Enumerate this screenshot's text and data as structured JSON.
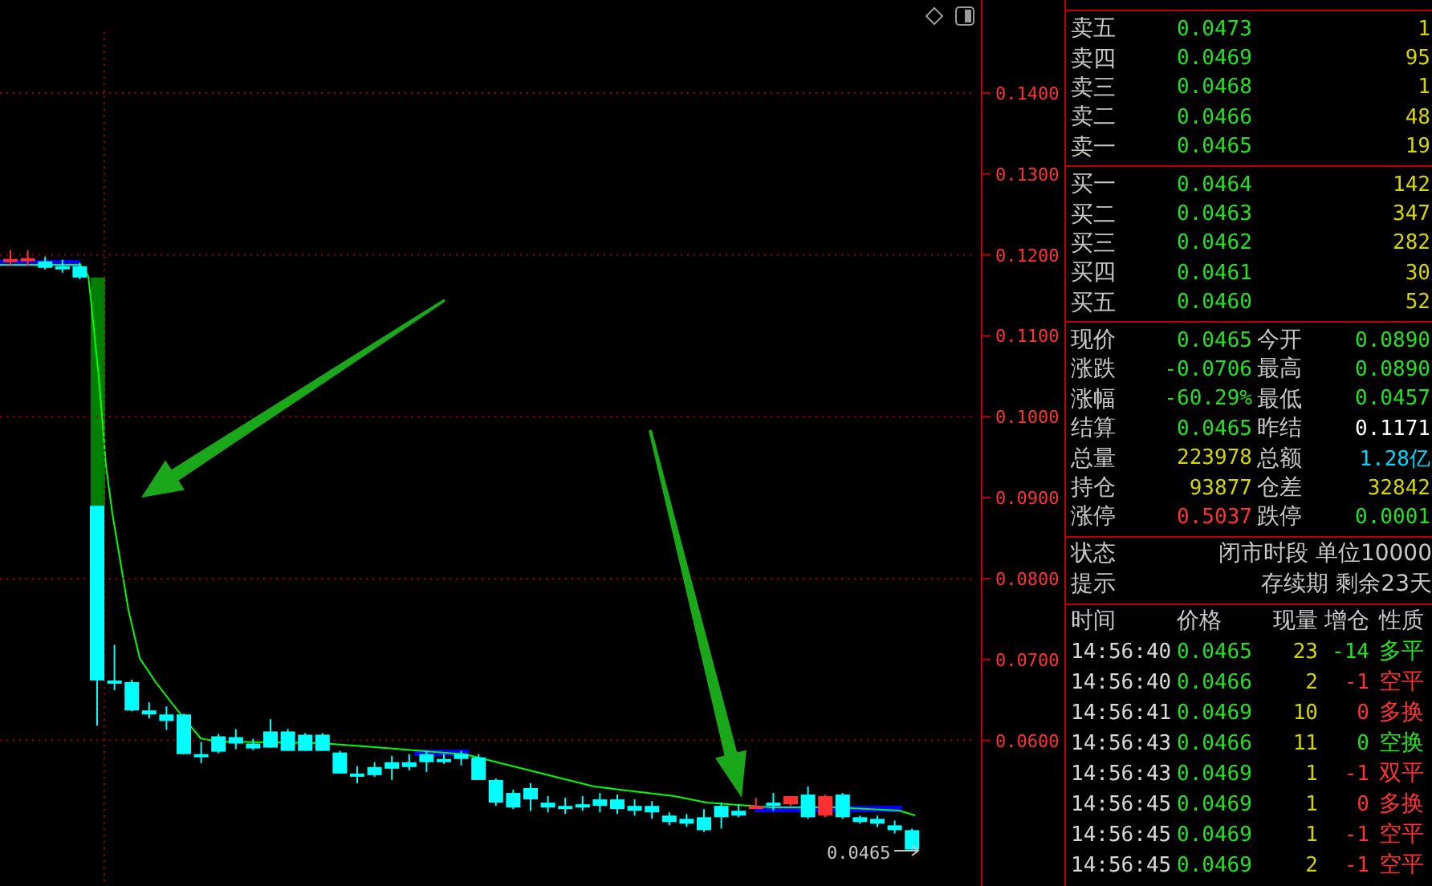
{
  "chart": {
    "chart_data": {
      "type": "candlestick",
      "grid": true,
      "ylim": [
        0.042,
        0.1515
      ],
      "yticks": [
        {
          "value": 0.14,
          "label": "0.1400"
        },
        {
          "value": 0.13,
          "label": "0.1300"
        },
        {
          "value": 0.12,
          "label": "0.1200"
        },
        {
          "value": 0.11,
          "label": "0.1100"
        },
        {
          "value": 0.1,
          "label": "0.1000"
        },
        {
          "value": 0.09,
          "label": "0.0900"
        },
        {
          "value": 0.08,
          "label": "0.0800"
        },
        {
          "value": 0.07,
          "label": "0.0700"
        },
        {
          "value": 0.06,
          "label": "0.0600"
        }
      ],
      "ohlc": [
        [
          0.1194,
          0.1206,
          0.1186,
          0.1195
        ],
        [
          0.1194,
          0.1206,
          0.1186,
          0.1196
        ],
        [
          0.1192,
          0.1198,
          0.1182,
          0.1184
        ],
        [
          0.1186,
          0.1194,
          0.1178,
          0.1186
        ],
        [
          0.1186,
          0.119,
          0.117,
          0.1172
        ],
        [
          0.089,
          0.089,
          0.0618,
          0.0674
        ],
        [
          0.0674,
          0.0718,
          0.0662,
          0.0674
        ],
        [
          0.0672,
          0.0675,
          0.0636,
          0.0637
        ],
        [
          0.0637,
          0.0647,
          0.0627,
          0.0632
        ],
        [
          0.0632,
          0.0642,
          0.0613,
          0.0624
        ],
        [
          0.0632,
          0.0633,
          0.0583,
          0.0583
        ],
        [
          0.0583,
          0.0598,
          0.0572,
          0.0583
        ],
        [
          0.0605,
          0.0608,
          0.0584,
          0.0586
        ],
        [
          0.0604,
          0.0614,
          0.0589,
          0.0596
        ],
        [
          0.0596,
          0.0602,
          0.0588,
          0.059
        ],
        [
          0.0611,
          0.0626,
          0.0591,
          0.0591
        ],
        [
          0.0611,
          0.0614,
          0.0587,
          0.0587
        ],
        [
          0.0607,
          0.0609,
          0.0587,
          0.0587
        ],
        [
          0.0607,
          0.0609,
          0.0587,
          0.0587
        ],
        [
          0.0585,
          0.0587,
          0.0559,
          0.0559
        ],
        [
          0.0559,
          0.0568,
          0.0547,
          0.0559
        ],
        [
          0.0567,
          0.0573,
          0.0555,
          0.0557
        ],
        [
          0.0573,
          0.0581,
          0.0551,
          0.0565
        ],
        [
          0.0573,
          0.0583,
          0.0563,
          0.0567
        ],
        [
          0.0583,
          0.0587,
          0.0561,
          0.0573
        ],
        [
          0.0577,
          0.0583,
          0.0571,
          0.0577
        ],
        [
          0.0583,
          0.0587,
          0.0569,
          0.0577
        ],
        [
          0.0579,
          0.0583,
          0.0551,
          0.0551
        ],
        [
          0.0551,
          0.0553,
          0.0519,
          0.0523
        ],
        [
          0.0535,
          0.0539,
          0.0515,
          0.0517
        ],
        [
          0.0541,
          0.0547,
          0.0513,
          0.0527
        ],
        [
          0.0523,
          0.0531,
          0.0511,
          0.0517
        ],
        [
          0.0519,
          0.0529,
          0.0509,
          0.0519
        ],
        [
          0.0521,
          0.0531,
          0.0513,
          0.0517
        ],
        [
          0.0527,
          0.0535,
          0.0511,
          0.0519
        ],
        [
          0.0527,
          0.0533,
          0.0509,
          0.0515
        ],
        [
          0.0519,
          0.0527,
          0.0507,
          0.0513
        ],
        [
          0.0519,
          0.0525,
          0.0503,
          0.0511
        ],
        [
          0.0507,
          0.0511,
          0.0495,
          0.0499
        ],
        [
          0.0503,
          0.0509,
          0.0493,
          0.0497
        ],
        [
          0.0505,
          0.0515,
          0.0487,
          0.0489
        ],
        [
          0.0519,
          0.0523,
          0.0491,
          0.0505
        ],
        [
          0.0513,
          0.0521,
          0.0505,
          0.0507
        ],
        [
          0.0518,
          0.0529,
          0.0517,
          0.0519
        ],
        [
          0.0523,
          0.0535,
          0.0513,
          0.0523
        ],
        [
          0.0521,
          0.0531,
          0.0519,
          0.0531
        ],
        [
          0.0533,
          0.0543,
          0.0503,
          0.0505
        ],
        [
          0.0507,
          0.0533,
          0.0505,
          0.0531
        ],
        [
          0.0533,
          0.0535,
          0.0503,
          0.0505
        ],
        [
          0.0505,
          0.0507,
          0.0497,
          0.0499
        ],
        [
          0.0503,
          0.0507,
          0.0493,
          0.0497
        ],
        [
          0.0495,
          0.0501,
          0.0485,
          0.0489
        ],
        [
          0.0489,
          0.0491,
          0.0463,
          0.0465
        ]
      ]
    },
    "last_price_label": "0.0465"
  },
  "order_book": {
    "asks": [
      {
        "label": "卖五",
        "price": "0.0473",
        "volume": "1"
      },
      {
        "label": "卖四",
        "price": "0.0469",
        "volume": "95"
      },
      {
        "label": "卖三",
        "price": "0.0468",
        "volume": "1"
      },
      {
        "label": "卖二",
        "price": "0.0466",
        "volume": "48"
      },
      {
        "label": "卖一",
        "price": "0.0465",
        "volume": "19"
      }
    ],
    "bids": [
      {
        "label": "买一",
        "price": "0.0464",
        "volume": "142"
      },
      {
        "label": "买二",
        "price": "0.0463",
        "volume": "347"
      },
      {
        "label": "买三",
        "price": "0.0462",
        "volume": "282"
      },
      {
        "label": "买四",
        "price": "0.0461",
        "volume": "30"
      },
      {
        "label": "买五",
        "price": "0.0460",
        "volume": "52"
      }
    ]
  },
  "quote": [
    {
      "label": "现价",
      "value": "0.0465",
      "color": "#22e022"
    },
    {
      "label": "今开",
      "value": "0.0890",
      "color": "#22e022"
    },
    {
      "label": "涨跌",
      "value": "-0.0706",
      "color": "#22e022"
    },
    {
      "label": "最高",
      "value": "0.0890",
      "color": "#22e022"
    },
    {
      "label": "涨幅",
      "value": "-60.29%",
      "color": "#22e022"
    },
    {
      "label": "最低",
      "value": "0.0457",
      "color": "#22e022"
    },
    {
      "label": "结算",
      "value": "0.0465",
      "color": "#22e022"
    },
    {
      "label": "昨结",
      "value": "0.1171",
      "color": "#ffffff"
    },
    {
      "label": "总量",
      "value": "223978",
      "color": "#d4d400"
    },
    {
      "label": "总额",
      "value": "1.28亿",
      "color": "#00d8ff"
    },
    {
      "label": "持仓",
      "value": "93877",
      "color": "#d4d400"
    },
    {
      "label": "仓差",
      "value": "32842",
      "color": "#d4d400"
    },
    {
      "label": "涨停",
      "value": "0.5037",
      "color": "#ff3232"
    },
    {
      "label": "跌停",
      "value": "0.0001",
      "color": "#22e022"
    }
  ],
  "status": [
    {
      "label": "状态",
      "value": "闭市时段 单位10000"
    },
    {
      "label": "提示",
      "value": "存续期 剩余23天"
    }
  ],
  "trades": {
    "columns": [
      "时间",
      "价格",
      "现量",
      "增仓",
      "性质"
    ],
    "rows": [
      {
        "time": "14:56:40",
        "price": "0.0465",
        "volume": "23",
        "oi_change": "-14",
        "nature": "多平",
        "color": "#22e022"
      },
      {
        "time": "14:56:40",
        "price": "0.0466",
        "volume": "2",
        "oi_change": "-1",
        "nature": "空平",
        "color": "#ff3232"
      },
      {
        "time": "14:56:41",
        "price": "0.0469",
        "volume": "10",
        "oi_change": "0",
        "nature": "多换",
        "color": "#ff3232"
      },
      {
        "time": "14:56:43",
        "price": "0.0466",
        "volume": "11",
        "oi_change": "0",
        "nature": "空换",
        "color": "#22e022"
      },
      {
        "time": "14:56:43",
        "price": "0.0469",
        "volume": "1",
        "oi_change": "-1",
        "nature": "双平",
        "color": "#ff3232"
      },
      {
        "time": "14:56:45",
        "price": "0.0469",
        "volume": "1",
        "oi_change": "0",
        "nature": "多换",
        "color": "#ff3232"
      },
      {
        "time": "14:56:45",
        "price": "0.0469",
        "volume": "1",
        "oi_change": "-1",
        "nature": "空平",
        "color": "#ff3232"
      },
      {
        "time": "14:56:45",
        "price": "0.0469",
        "volume": "2",
        "oi_change": "-1",
        "nature": "空平",
        "color": "#ff3232"
      }
    ]
  }
}
